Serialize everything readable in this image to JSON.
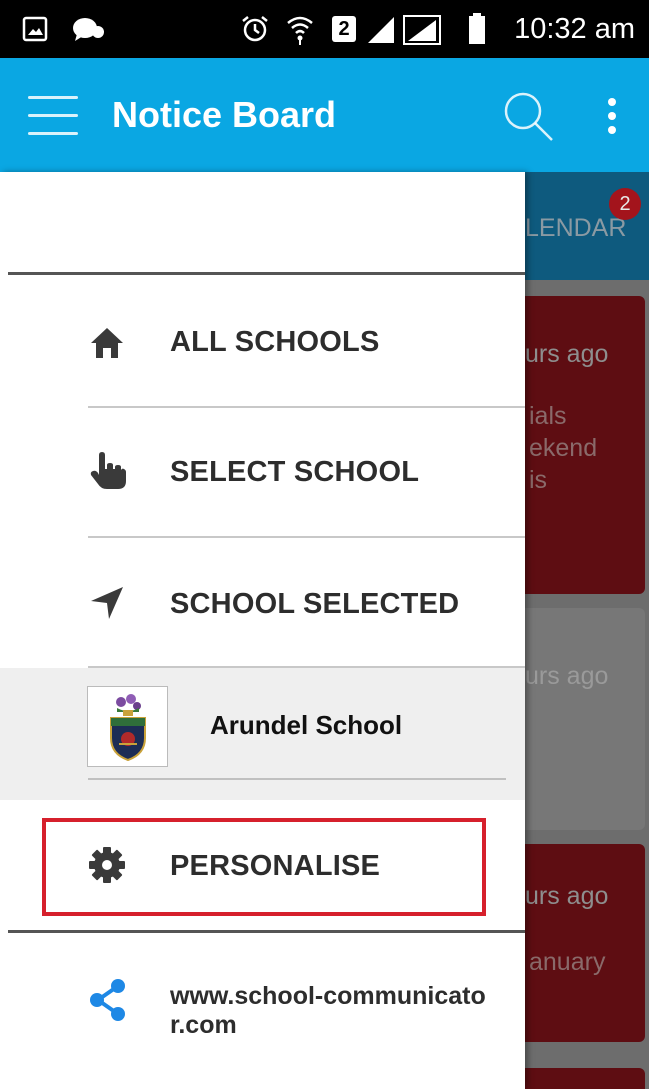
{
  "status_bar": {
    "time": "10:32 am",
    "sim_label": "2",
    "icons": [
      "gallery-icon",
      "chat-icon",
      "alarm-icon",
      "wifi-icon",
      "sim-icon",
      "signal-icon",
      "battery-icon"
    ]
  },
  "app_bar": {
    "title": "Notice Board",
    "color": "#0aa7e3",
    "icons": [
      "hamburger-menu-icon",
      "search-icon",
      "more-vert-icon"
    ]
  },
  "background": {
    "tab_label": "LENDAR",
    "badge_count": "2",
    "cards": [
      {
        "ago": "urs ago",
        "lines": [
          "ials",
          "ekend",
          "is"
        ]
      },
      {
        "ago": "urs ago",
        "lines": []
      },
      {
        "ago": "urs ago",
        "lines": [
          "anuary"
        ]
      }
    ]
  },
  "drawer": {
    "items": [
      {
        "label": "ALL SCHOOLS",
        "icon": "home-icon"
      },
      {
        "label": "SELECT SCHOOL",
        "icon": "pointer-hand-icon"
      },
      {
        "label": "SCHOOL SELECTED",
        "icon": "navigation-arrow-icon"
      }
    ],
    "school": {
      "name": "Arundel School",
      "logo": "school-crest-icon"
    },
    "personalise": {
      "label": "PERSONALISE",
      "icon": "gear-icon"
    },
    "share": {
      "url": "www.school-communicator.com",
      "icon": "share-icon",
      "color": "#1e88e5"
    },
    "highlight_color": "#d6202c"
  }
}
